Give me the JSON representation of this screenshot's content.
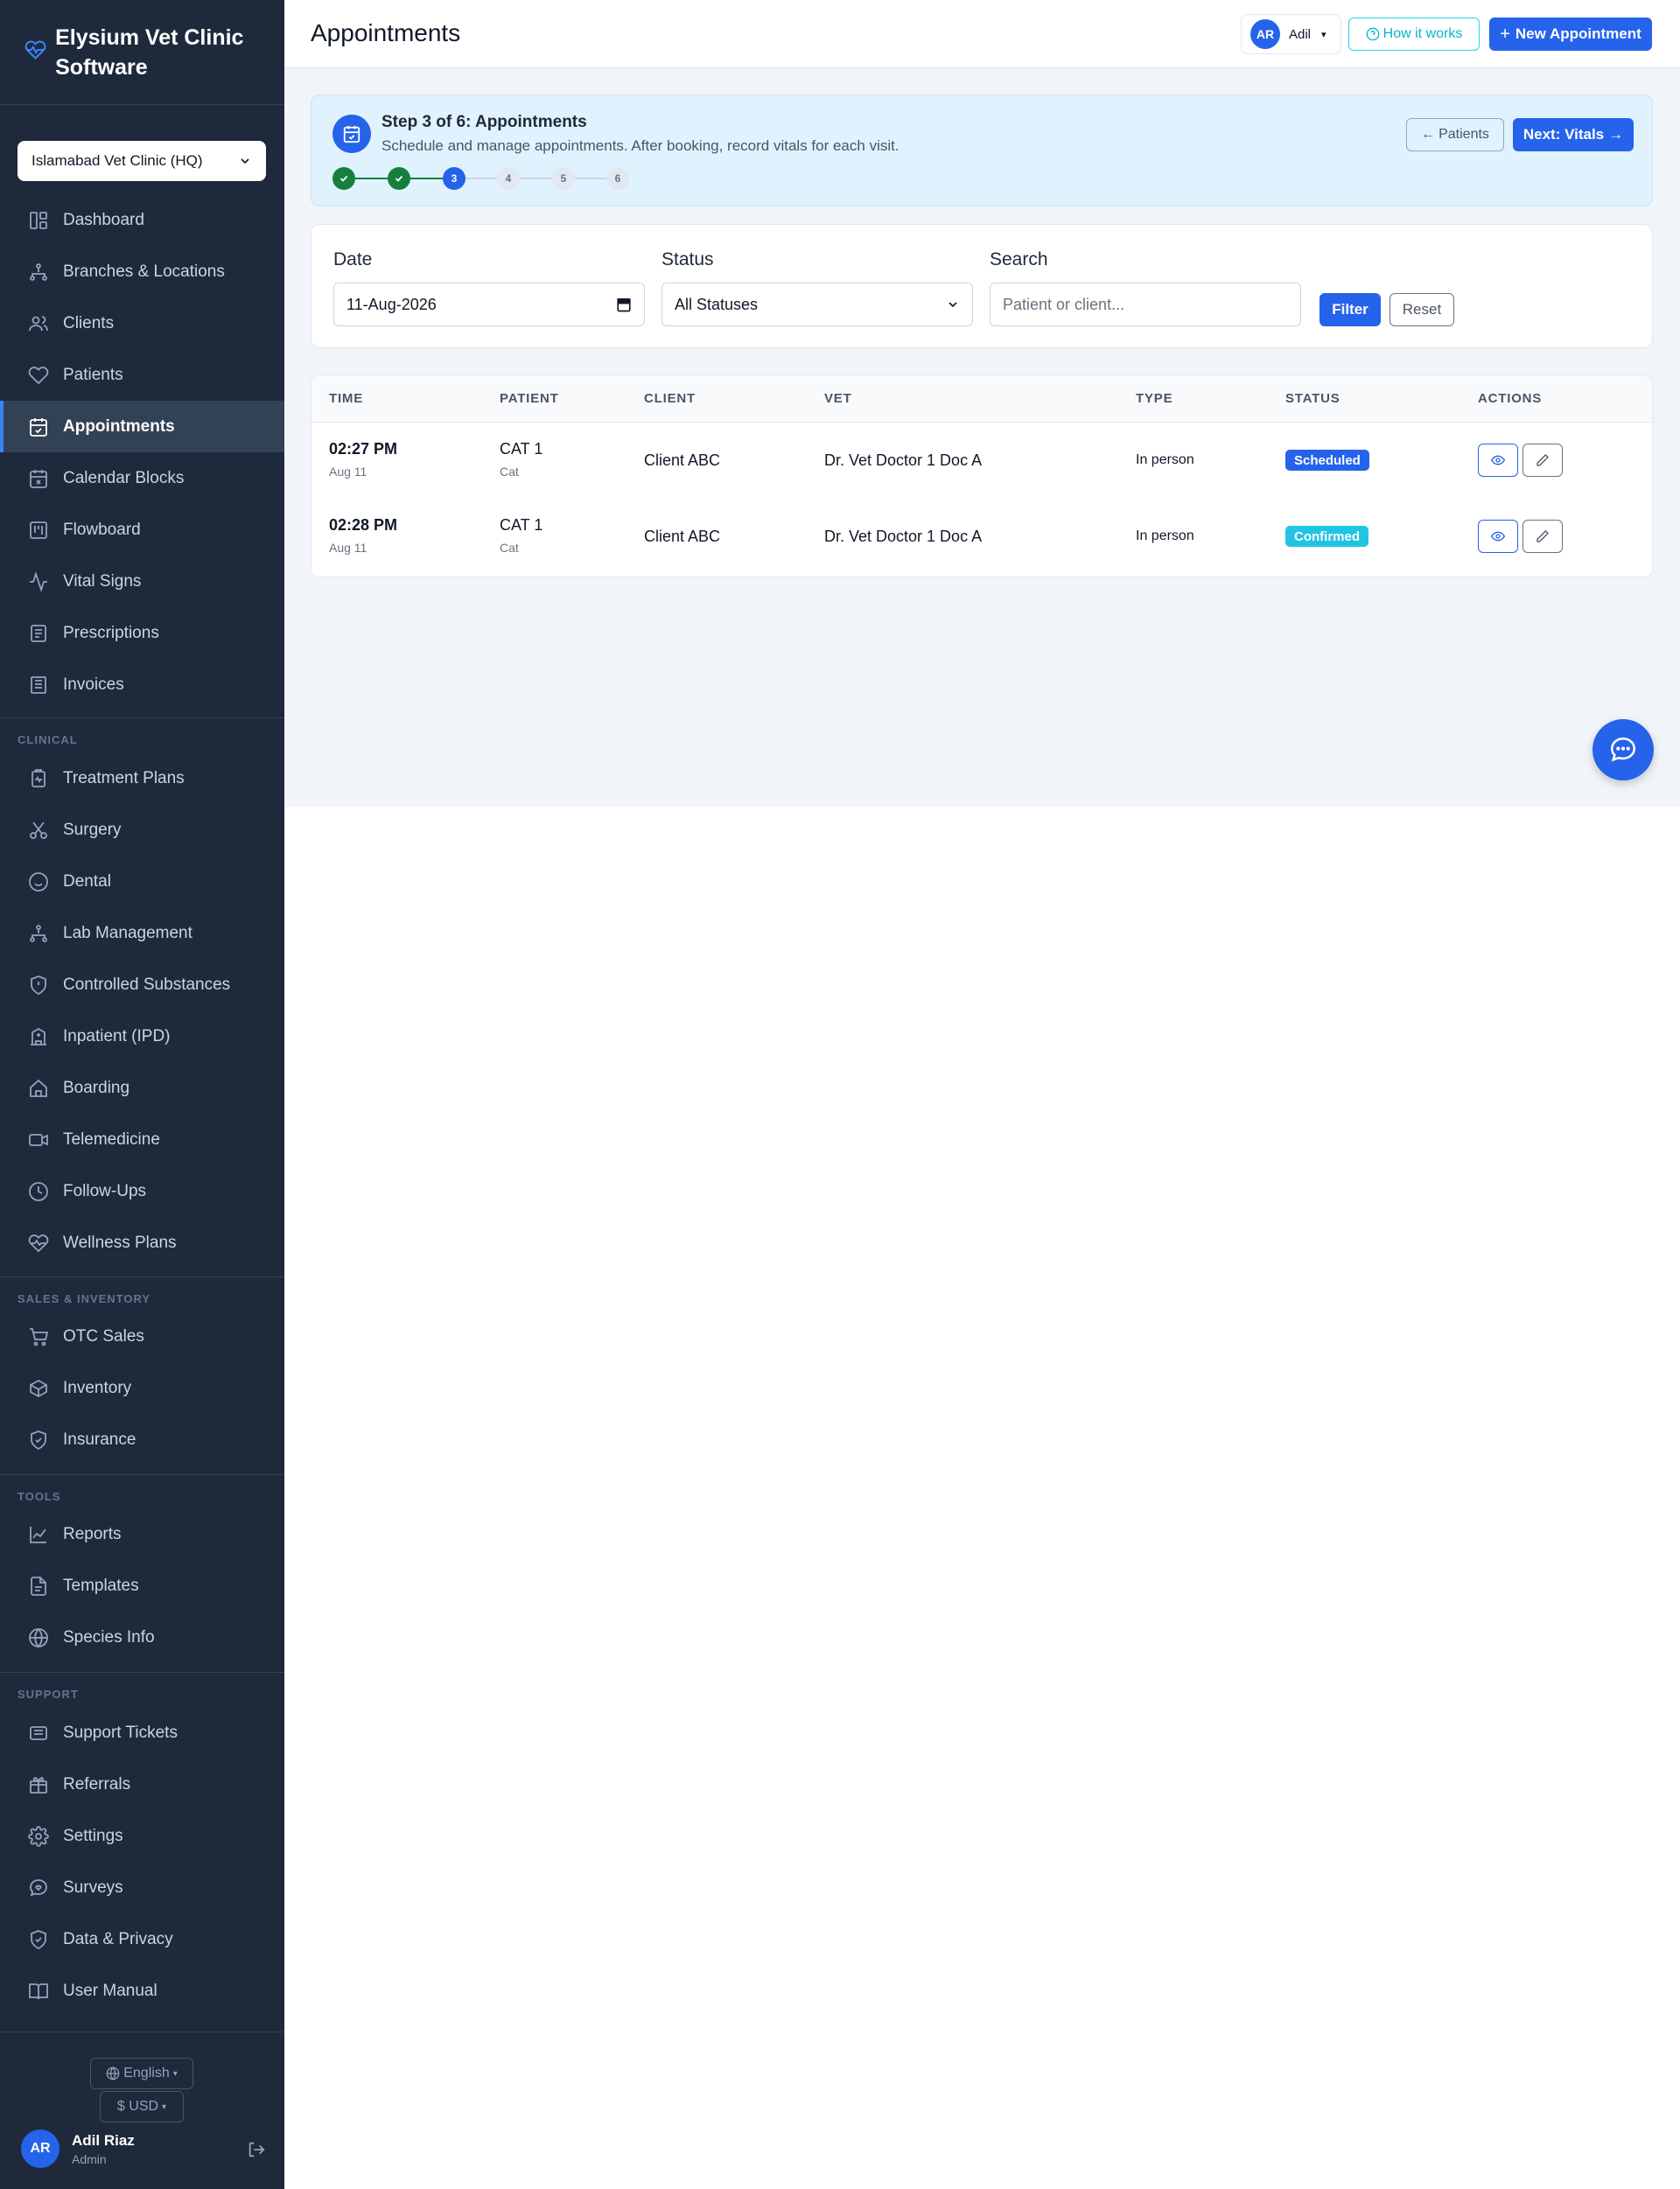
{
  "brand": {
    "title": "Elysium Vet Clinic Software"
  },
  "clinic_selector": {
    "value": "Islamabad Vet Clinic (HQ)"
  },
  "sidebar": {
    "main_items": [
      {
        "label": "Dashboard",
        "icon": "dashboard-icon"
      },
      {
        "label": "Branches & Locations",
        "icon": "branches-icon"
      },
      {
        "label": "Clients",
        "icon": "users-icon"
      },
      {
        "label": "Patients",
        "icon": "heart-icon"
      },
      {
        "label": "Appointments",
        "icon": "calendar-check-icon",
        "active": true
      },
      {
        "label": "Calendar Blocks",
        "icon": "calendar-x-icon"
      },
      {
        "label": "Flowboard",
        "icon": "kanban-icon"
      },
      {
        "label": "Vital Signs",
        "icon": "activity-icon"
      },
      {
        "label": "Prescriptions",
        "icon": "prescription-icon"
      },
      {
        "label": "Invoices",
        "icon": "invoice-icon"
      }
    ],
    "sections": [
      {
        "label": "CLINICAL",
        "items": [
          {
            "label": "Treatment Plans",
            "icon": "clipboard-icon"
          },
          {
            "label": "Surgery",
            "icon": "scissors-icon"
          },
          {
            "label": "Dental",
            "icon": "smile-icon"
          },
          {
            "label": "Lab Management",
            "icon": "lab-icon"
          },
          {
            "label": "Controlled Substances",
            "icon": "shield-alert-icon"
          },
          {
            "label": "Inpatient (IPD)",
            "icon": "hospital-icon"
          },
          {
            "label": "Boarding",
            "icon": "home-icon"
          },
          {
            "label": "Telemedicine",
            "icon": "video-icon"
          },
          {
            "label": "Follow-Ups",
            "icon": "clock-icon"
          },
          {
            "label": "Wellness Plans",
            "icon": "heart-pulse-icon"
          }
        ]
      },
      {
        "label": "SALES & INVENTORY",
        "items": [
          {
            "label": "OTC Sales",
            "icon": "cart-icon"
          },
          {
            "label": "Inventory",
            "icon": "box-icon"
          },
          {
            "label": "Insurance",
            "icon": "shield-check-icon"
          }
        ]
      },
      {
        "label": "TOOLS",
        "items": [
          {
            "label": "Reports",
            "icon": "chart-line-icon"
          },
          {
            "label": "Templates",
            "icon": "file-icon"
          },
          {
            "label": "Species Info",
            "icon": "globe-icon"
          }
        ]
      },
      {
        "label": "SUPPORT",
        "items": [
          {
            "label": "Support Tickets",
            "icon": "ticket-icon"
          },
          {
            "label": "Referrals",
            "icon": "gift-icon"
          },
          {
            "label": "Settings",
            "icon": "gear-icon"
          },
          {
            "label": "Surveys",
            "icon": "message-heart-icon"
          },
          {
            "label": "Data & Privacy",
            "icon": "shield-lock-icon"
          },
          {
            "label": "User Manual",
            "icon": "book-icon"
          }
        ]
      }
    ],
    "language": "English",
    "currency": "$ USD",
    "user": {
      "initials": "AR",
      "name": "Adil Riaz",
      "role": "Admin"
    }
  },
  "header": {
    "title": "Appointments",
    "user_chip": {
      "initials": "AR",
      "name": "Adil"
    },
    "how_it_works": "How it works",
    "new_appointment": "New Appointment"
  },
  "wizard": {
    "title": "Step 3 of 6: Appointments",
    "subtitle": "Schedule and manage appointments. After booking, record vitals for each visit.",
    "steps": [
      {
        "label": "",
        "state": "done"
      },
      {
        "label": "",
        "state": "done"
      },
      {
        "label": "3",
        "state": "current"
      },
      {
        "label": "4",
        "state": "pending"
      },
      {
        "label": "5",
        "state": "pending"
      },
      {
        "label": "6",
        "state": "pending"
      }
    ],
    "prev": "Patients",
    "next": "Next: Vitals"
  },
  "filters": {
    "date_label": "Date",
    "date_value": "11-Aug-2026",
    "status_label": "Status",
    "status_value": "All Statuses",
    "search_label": "Search",
    "search_placeholder": "Patient or client...",
    "filter_button": "Filter",
    "reset_button": "Reset"
  },
  "table": {
    "columns": [
      "TIME",
      "PATIENT",
      "CLIENT",
      "VET",
      "TYPE",
      "STATUS",
      "ACTIONS"
    ],
    "rows": [
      {
        "time": "02:27 PM",
        "date": "Aug 11",
        "patient": "CAT 1",
        "species": "Cat",
        "client": "Client ABC",
        "vet": "Dr. Vet Doctor 1 Doc A",
        "type": "In person",
        "status": "Scheduled",
        "status_color": "#2563eb"
      },
      {
        "time": "02:28 PM",
        "date": "Aug 11",
        "patient": "CAT 1",
        "species": "Cat",
        "client": "Client ABC",
        "vet": "Dr. Vet Doctor 1 Doc A",
        "type": "In person",
        "status": "Confirmed",
        "status_color": "#22c4e6"
      }
    ]
  },
  "colors": {
    "accent": "#2563eb",
    "sidebar_bg": "#1e293b",
    "success": "#15803d"
  }
}
